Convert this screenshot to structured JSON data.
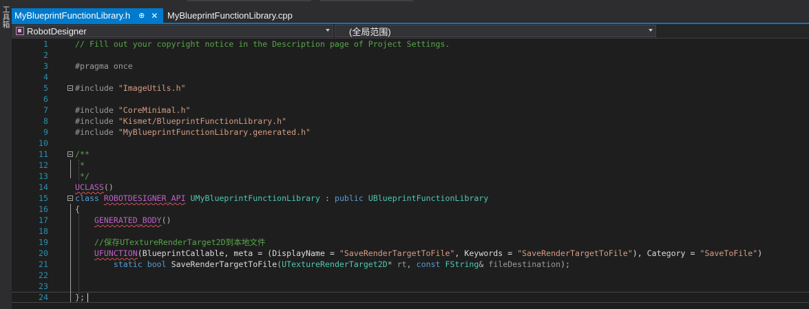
{
  "side_panel": {
    "label": "工具箱"
  },
  "tabs": [
    {
      "label": "MyBlueprintFunctionLibrary.h",
      "pin": "⊕",
      "close": "✕",
      "active": true
    },
    {
      "label": "MyBlueprintFunctionLibrary.cpp",
      "active": false
    }
  ],
  "navigation": {
    "project_combo": "RobotDesigner",
    "scope_combo": "(全局范围)"
  },
  "editor": {
    "lines": [
      {
        "n": "1",
        "tokens": [
          {
            "t": "// Fill out your copyright notice in the Description page of Project Settings.",
            "c": "comment"
          }
        ]
      },
      {
        "n": "2",
        "tokens": []
      },
      {
        "n": "3",
        "tokens": [
          {
            "t": "#pragma once",
            "c": "directive"
          }
        ]
      },
      {
        "n": "4",
        "tokens": []
      },
      {
        "n": "5",
        "tokens": [
          {
            "t": "#include ",
            "c": "directive"
          },
          {
            "t": "\"ImageUtils.h\"",
            "c": "string"
          }
        ]
      },
      {
        "n": "6",
        "tokens": []
      },
      {
        "n": "7",
        "tokens": [
          {
            "t": "#include ",
            "c": "directive"
          },
          {
            "t": "\"CoreMinimal.h\"",
            "c": "string"
          }
        ]
      },
      {
        "n": "8",
        "tokens": [
          {
            "t": "#include ",
            "c": "directive"
          },
          {
            "t": "\"Kismet/BlueprintFunctionLibrary.h\"",
            "c": "string"
          }
        ]
      },
      {
        "n": "9",
        "tokens": [
          {
            "t": "#include ",
            "c": "directive"
          },
          {
            "t": "\"MyBlueprintFunctionLibrary.generated.h\"",
            "c": "string"
          }
        ]
      },
      {
        "n": "10",
        "tokens": []
      },
      {
        "n": "11",
        "tokens": [
          {
            "t": "/**",
            "c": "comment"
          }
        ]
      },
      {
        "n": "12",
        "tokens": [
          {
            "t": " *",
            "c": "comment"
          }
        ]
      },
      {
        "n": "13",
        "tokens": [
          {
            "t": " */",
            "c": "comment"
          }
        ]
      },
      {
        "n": "14",
        "tokens": [
          {
            "t": "UCLASS",
            "c": "macro",
            "squiggle": true
          },
          {
            "t": "()",
            "c": "plain"
          }
        ]
      },
      {
        "n": "15",
        "tokens": [
          {
            "t": "class ",
            "c": "keyword"
          },
          {
            "t": "ROBOTDESIGNER_API",
            "c": "macro",
            "squiggle": true
          },
          {
            "t": " ",
            "c": "plain"
          },
          {
            "t": "UMyBlueprintFunctionLibrary",
            "c": "type"
          },
          {
            "t": " : ",
            "c": "plain"
          },
          {
            "t": "public ",
            "c": "keyword"
          },
          {
            "t": "UBlueprintFunctionLibrary",
            "c": "type"
          }
        ]
      },
      {
        "n": "16",
        "tokens": [
          {
            "t": "{",
            "c": "plain"
          }
        ]
      },
      {
        "n": "17",
        "tokens": [
          {
            "t": "    ",
            "c": "plain"
          },
          {
            "t": "GENERATED_BODY",
            "c": "macro",
            "squiggle": true
          },
          {
            "t": "()",
            "c": "plain"
          }
        ]
      },
      {
        "n": "18",
        "tokens": []
      },
      {
        "n": "19",
        "tokens": [
          {
            "t": "    //保存UTextureRenderTarget2D到本地文件",
            "c": "comment"
          }
        ]
      },
      {
        "n": "20",
        "tokens": [
          {
            "t": "    ",
            "c": "plain"
          },
          {
            "t": "UFUNCTION",
            "c": "macro",
            "squiggle": true
          },
          {
            "t": "(BlueprintCallable, meta = (DisplayName = ",
            "c": "ident"
          },
          {
            "t": "\"SaveRenderTargetToFile\"",
            "c": "string"
          },
          {
            "t": ", Keywords = ",
            "c": "ident"
          },
          {
            "t": "\"SaveRenderTargetToFile\"",
            "c": "string"
          },
          {
            "t": "), Category = ",
            "c": "ident"
          },
          {
            "t": "\"SaveToFile\"",
            "c": "string"
          },
          {
            "t": ")",
            "c": "ident"
          }
        ]
      },
      {
        "n": "21",
        "tokens": [
          {
            "t": "        ",
            "c": "plain"
          },
          {
            "t": "static ",
            "c": "keyword"
          },
          {
            "t": "bool ",
            "c": "keyword"
          },
          {
            "t": "SaveRenderTargetToFile",
            "c": "ident"
          },
          {
            "t": "(",
            "c": "plain"
          },
          {
            "t": "UTextureRenderTarget2D",
            "c": "type"
          },
          {
            "t": "* ",
            "c": "plain"
          },
          {
            "t": "rt",
            "c": "param"
          },
          {
            "t": ", ",
            "c": "plain"
          },
          {
            "t": "const ",
            "c": "keyword"
          },
          {
            "t": "FString",
            "c": "type"
          },
          {
            "t": "& ",
            "c": "plain"
          },
          {
            "t": "fileDestination",
            "c": "param"
          },
          {
            "t": ");",
            "c": "plain"
          }
        ]
      },
      {
        "n": "22",
        "tokens": []
      },
      {
        "n": "23",
        "tokens": []
      },
      {
        "n": "24",
        "tokens": [
          {
            "t": "};",
            "c": "plain"
          }
        ]
      }
    ]
  }
}
